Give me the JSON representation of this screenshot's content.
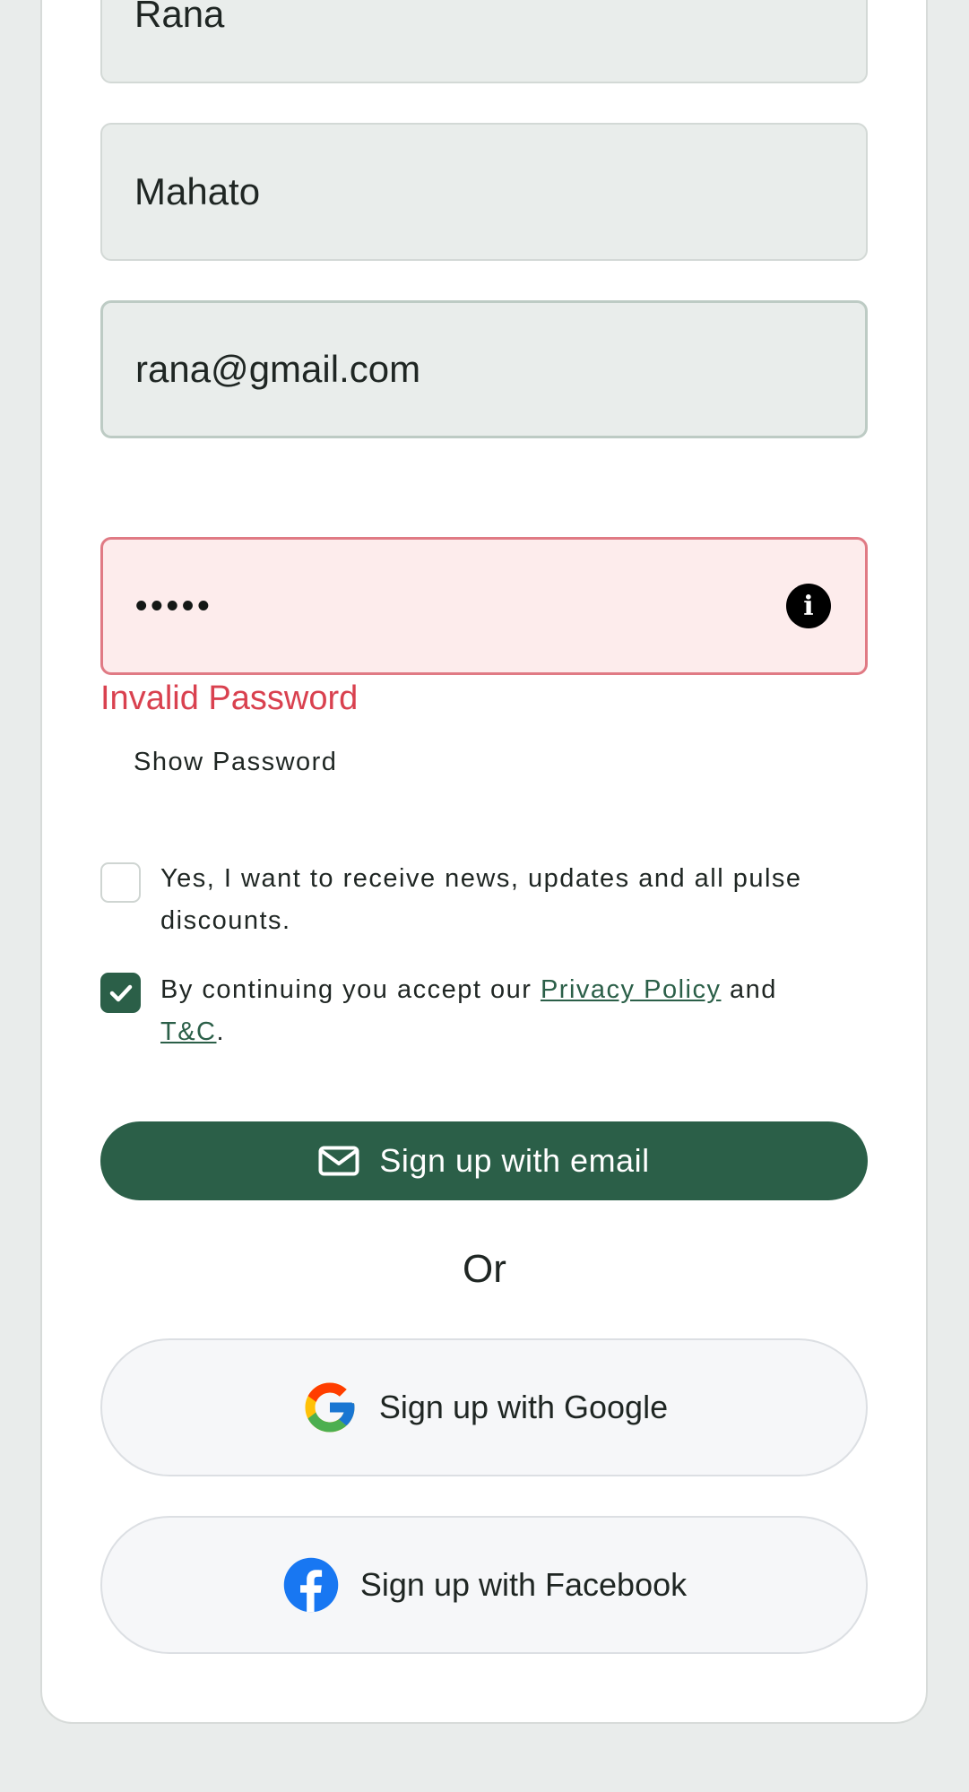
{
  "form": {
    "first_name_value": "Rana",
    "last_name_value": "Mahato",
    "email_value": "rana@gmail.com",
    "password_mask": "•••••",
    "password_error": "Invalid Password",
    "show_password_label": "Show Password",
    "newsletter_label": "Yes, I want to receive news, updates and all pulse discounts.",
    "newsletter_checked": false,
    "terms_prefix": "By continuing you accept our ",
    "privacy_link": "Privacy Policy",
    "terms_and": " and",
    "terms_link": "T&C",
    "terms_suffix": ".",
    "terms_checked": true
  },
  "buttons": {
    "email_signup": "Sign up with email",
    "or_divider": "Or",
    "google_signup": "Sign up with Google",
    "facebook_signup": "Sign up with Facebook"
  },
  "icons": {
    "password_info": "info-icon",
    "email_button": "envelope-icon",
    "google": "google-logo-icon",
    "facebook": "facebook-logo-icon",
    "checkbox_checked": "checkmark-icon"
  },
  "colors": {
    "primary": "#2b5f48",
    "error": "#d9414f",
    "error_bg": "#fdecec",
    "facebook_blue": "#1877f2",
    "page_bg": "#e9eceb"
  }
}
